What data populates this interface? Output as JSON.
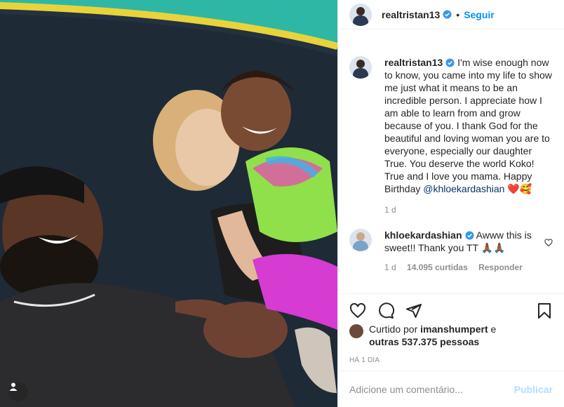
{
  "post": {
    "author": "realtristan13",
    "follow_label": "Seguir",
    "caption_author": "realtristan13",
    "caption_text": " I'm wise enough now to know, you came into my life to show me just what it means to be an incredible person. I appreciate how I am able to learn from and grow because of you. I thank God for the beautiful and loving woman you are to everyone, especially our daughter True. You deserve the world Koko! True and I love you mama. Happy Birthday ",
    "caption_mention": "@khloekardashian",
    "caption_emoji": "❤️🥰",
    "caption_time": "1 d"
  },
  "comment": {
    "author": "khloekardashian",
    "text": " Awww this is sweet!! Thank you TT 🙏🏾🙏🏾",
    "time": "1 d",
    "likes": "14.095 curtidas",
    "reply": "Responder"
  },
  "likes": {
    "prefix": "Curtido por ",
    "user": "imanshumpert",
    "middle": " e ",
    "others": "outras 537.375 pessoas"
  },
  "posted_ago": "HÁ 1 DIA",
  "add_comment": {
    "placeholder": "Adicione um comentário...",
    "publish": "Publicar"
  },
  "colors": {
    "accent": "#0095f6",
    "verified": "#3897f0",
    "publish_disabled": "#b2dffc"
  },
  "icons": [
    "verified-icon",
    "heart-icon",
    "comment-icon",
    "share-icon",
    "bookmark-icon",
    "user-tag-icon"
  ]
}
